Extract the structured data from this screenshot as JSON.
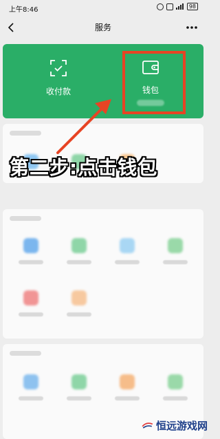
{
  "status_bar": {
    "time": "上午8:46",
    "battery": "98"
  },
  "nav": {
    "title": "服务"
  },
  "wallet_card": {
    "actions": [
      {
        "label": "收付款",
        "icon": "qr-scan-icon"
      },
      {
        "label": "钱包",
        "icon": "wallet-icon"
      }
    ]
  },
  "annotation": {
    "callout_text": "第二步:点击钱包"
  },
  "watermark": {
    "text": "恒远游戏网"
  },
  "colors": {
    "card_green": "#2aae67",
    "highlight_red": "#e74424",
    "background": "#ededed"
  }
}
